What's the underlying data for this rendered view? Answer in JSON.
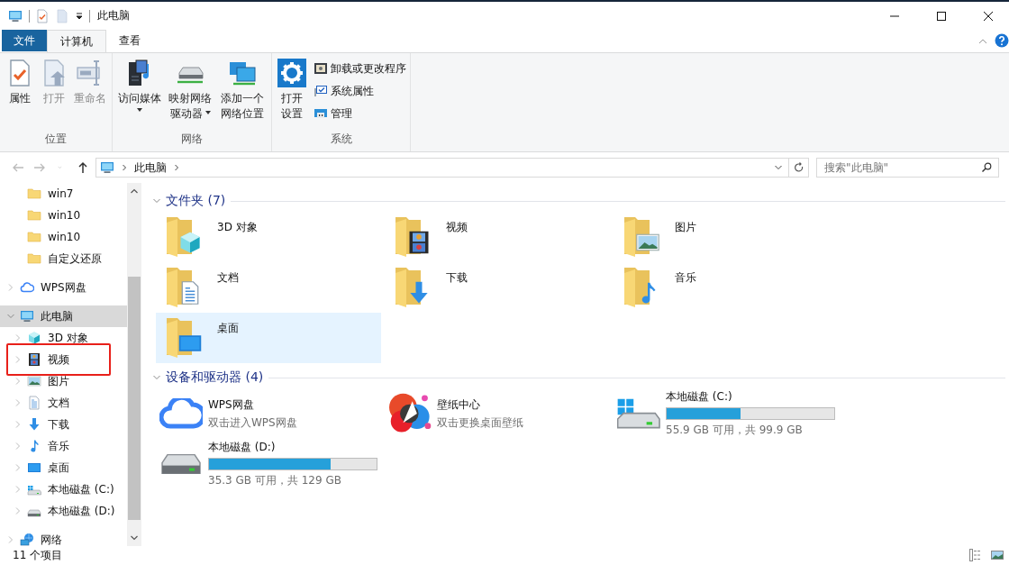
{
  "window": {
    "title": "此电脑"
  },
  "tabs": [
    {
      "label": "文件",
      "kind": "file"
    },
    {
      "label": "计算机",
      "kind": "tab",
      "selected": true
    },
    {
      "label": "查看",
      "kind": "tab",
      "selected": false
    }
  ],
  "ribbon": {
    "groups": [
      {
        "label": "位置",
        "buttons": [
          {
            "label": "属性",
            "kind": "properties",
            "disabled": false,
            "dropdown": false
          },
          {
            "label": "打开",
            "kind": "open",
            "disabled": true,
            "dropdown": false
          },
          {
            "label": "重命名",
            "kind": "rename",
            "disabled": true,
            "dropdown": false
          }
        ]
      },
      {
        "label": "网络",
        "buttons": [
          {
            "label": "访问媒体",
            "kind": "media",
            "disabled": false,
            "dropdown": true
          },
          {
            "label": "映射网络驱动器",
            "kind": "mapdrive",
            "disabled": false,
            "dropdown": true
          },
          {
            "label": "添加一个网络位置",
            "kind": "netlocation",
            "disabled": false,
            "dropdown": false
          }
        ]
      },
      {
        "label": "系统",
        "buttons": [
          {
            "label": "打开设置",
            "kind": "settings",
            "disabled": false,
            "dropdown": false
          }
        ],
        "small_buttons": [
          {
            "label": "卸载或更改程序",
            "kind": "uninstall"
          },
          {
            "label": "系统属性",
            "kind": "sysprops"
          },
          {
            "label": "管理",
            "kind": "manage"
          }
        ]
      }
    ]
  },
  "nav": [
    {
      "kind": "back",
      "disabled": true
    },
    {
      "kind": "forward",
      "disabled": true
    },
    {
      "kind": "recent",
      "disabled": true
    },
    {
      "kind": "up",
      "disabled": false
    }
  ],
  "address": {
    "path": [
      "此电脑"
    ],
    "search": {
      "placeholder": "搜索\"此电脑\""
    }
  },
  "sidebar": {
    "partial_items": [
      {
        "label": "win7",
        "kind": "folder"
      },
      {
        "label": "win10",
        "kind": "folder"
      },
      {
        "label": "win10",
        "kind": "folder"
      },
      {
        "label": "自定义还原",
        "kind": "folder"
      }
    ],
    "items": [
      {
        "label": "WPS网盘",
        "kind": "cloud",
        "expanded": false,
        "selected": false
      },
      {
        "label": "此电脑",
        "kind": "pc",
        "expanded": true,
        "selected": true,
        "children": [
          {
            "label": "3D 对象",
            "kind": "cube",
            "expanded": false,
            "selected": false,
            "highlighted": false
          },
          {
            "label": "视频",
            "kind": "film",
            "expanded": false,
            "selected": false,
            "highlighted": true
          },
          {
            "label": "图片",
            "kind": "picture",
            "expanded": false,
            "selected": false,
            "highlighted": false
          },
          {
            "label": "文档",
            "kind": "doc",
            "expanded": false,
            "selected": false,
            "highlighted": false
          },
          {
            "label": "下载",
            "kind": "download",
            "expanded": false,
            "selected": false,
            "highlighted": false
          },
          {
            "label": "音乐",
            "kind": "music",
            "expanded": false,
            "selected": false,
            "highlighted": false
          },
          {
            "label": "桌面",
            "kind": "desktop",
            "expanded": false,
            "selected": false,
            "highlighted": false
          },
          {
            "label": "本地磁盘 (C:)",
            "kind": "windrive",
            "expanded": false,
            "selected": false,
            "highlighted": false
          },
          {
            "label": "本地磁盘 (D:)",
            "kind": "drive",
            "expanded": false,
            "selected": false,
            "highlighted": false
          }
        ]
      },
      {
        "label": "网络",
        "kind": "network",
        "expanded": false,
        "selected": false
      }
    ]
  },
  "content": {
    "folders": {
      "title": "文件夹 (7)",
      "expanded": true,
      "items": [
        {
          "label": "3D 对象",
          "kind": "cube",
          "selected": false
        },
        {
          "label": "视频",
          "kind": "film",
          "selected": false
        },
        {
          "label": "图片",
          "kind": "picture",
          "selected": false
        },
        {
          "label": "文档",
          "kind": "doc",
          "selected": false
        },
        {
          "label": "下载",
          "kind": "download",
          "selected": false
        },
        {
          "label": "音乐",
          "kind": "music",
          "selected": false
        },
        {
          "label": "桌面",
          "kind": "desktop",
          "selected": true
        }
      ]
    },
    "devices": {
      "title": "设备和驱动器 (4)",
      "expanded": true,
      "items": [
        {
          "kind": "cloud",
          "label": "WPS网盘",
          "subtitle": "双击进入WPS网盘"
        },
        {
          "kind": "wallpaper",
          "label": "壁纸中心",
          "subtitle": "双击更换桌面壁纸"
        },
        {
          "kind": "windrive",
          "label": "本地磁盘 (C:)",
          "level": 0.44,
          "reading": "55.9 GB 可用，共 99.9 GB"
        },
        {
          "kind": "drive",
          "label": "本地磁盘 (D:)",
          "level": 0.726,
          "reading": "35.3 GB 可用，共 129 GB"
        }
      ]
    }
  },
  "status_bar": {
    "count": "11 个项目"
  }
}
